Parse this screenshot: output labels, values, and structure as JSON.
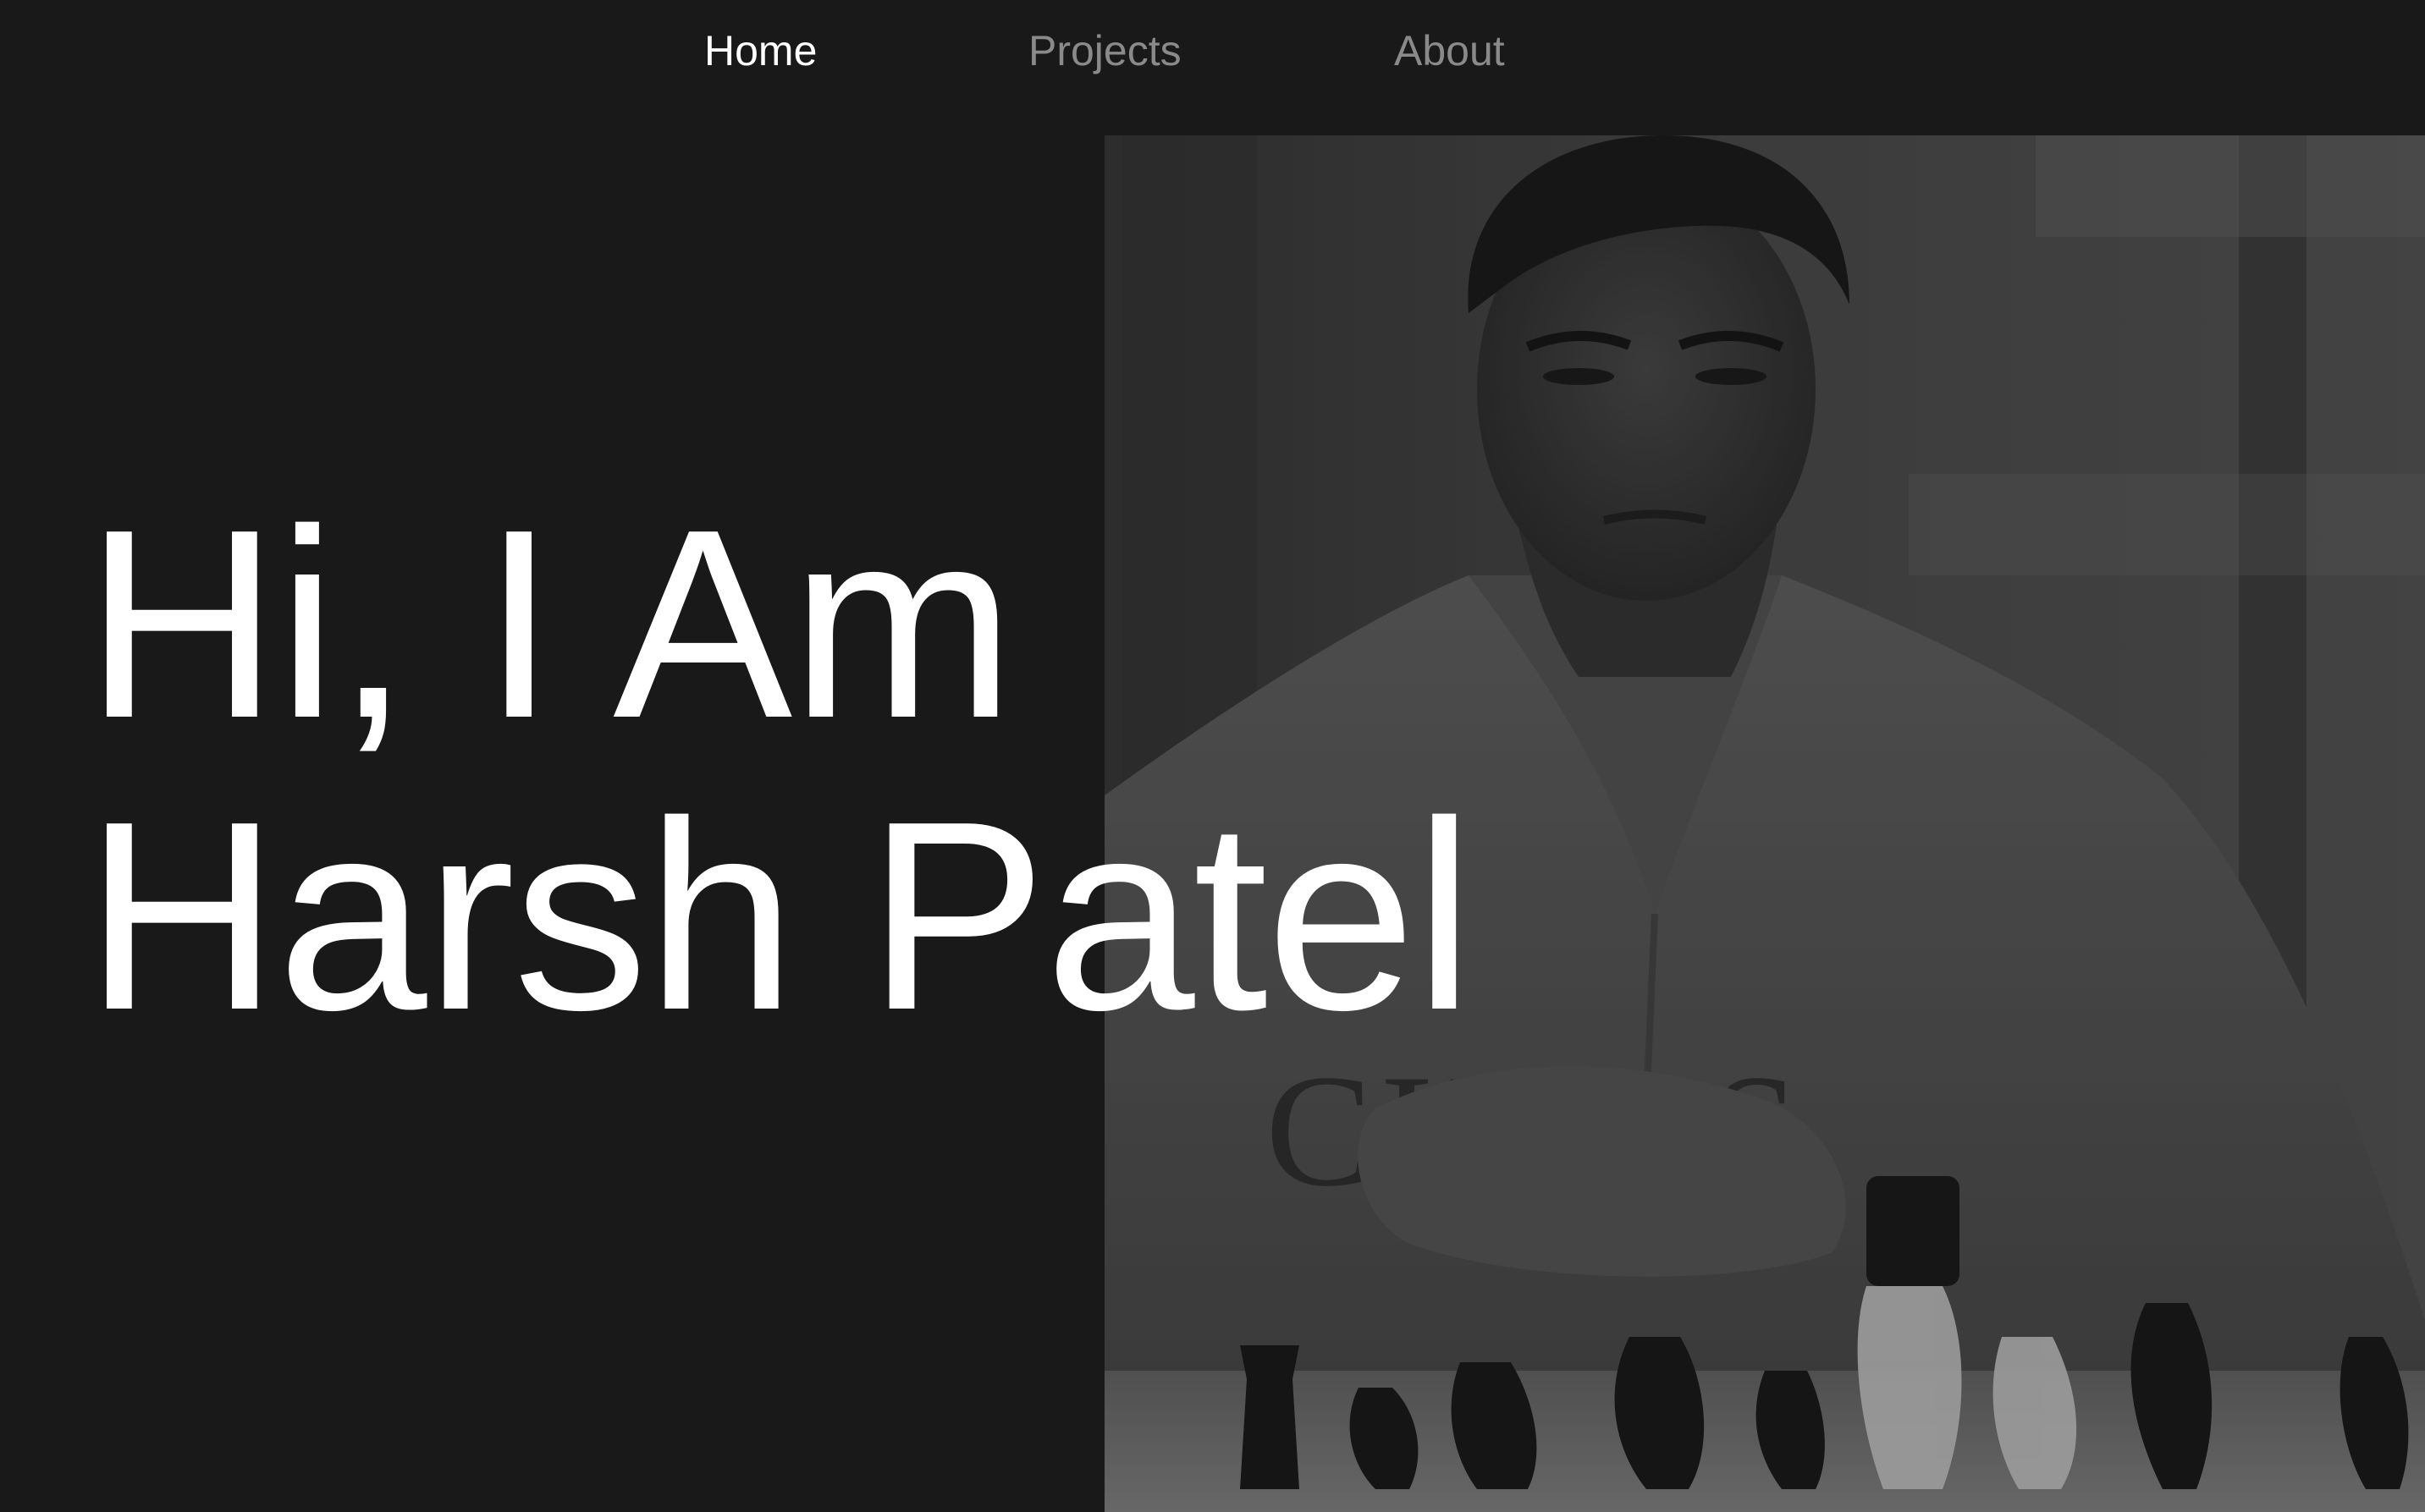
{
  "nav": {
    "items": [
      {
        "label": "Home",
        "active": true
      },
      {
        "label": "Projects",
        "active": false
      },
      {
        "label": "About",
        "active": false
      }
    ]
  },
  "hero": {
    "line1": "Hi, I Am",
    "line2": "Harsh Patel",
    "photo_subject": "grayscale portrait of a man playing chess"
  },
  "colors": {
    "background": "#191919",
    "nav_active": "#ffffff",
    "nav_inactive": "#8a8a8a",
    "headline": "#ffffff"
  }
}
